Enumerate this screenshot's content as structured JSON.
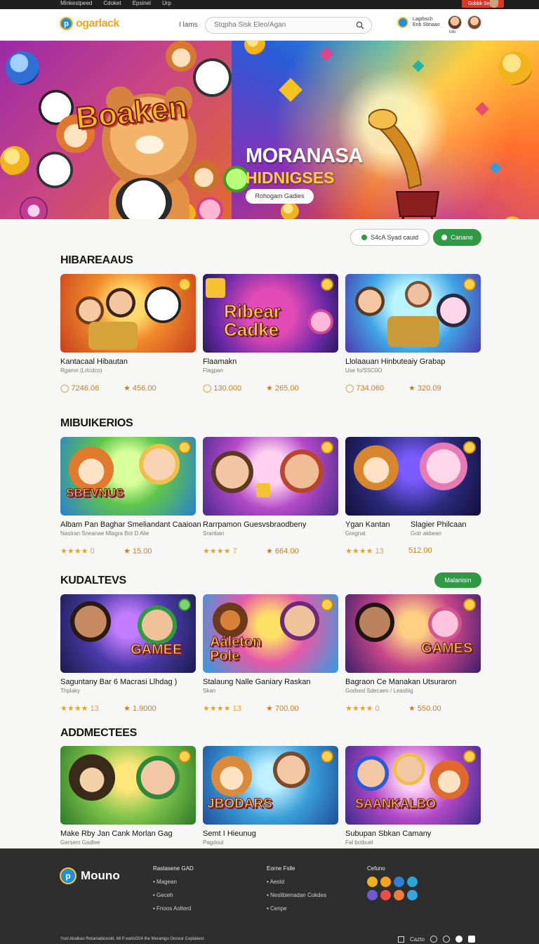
{
  "topbar": {
    "links": [
      "Minkestpeed",
      "Cdoket",
      "Epsinel",
      "Urp"
    ],
    "red_button": "Gobbk Sepho"
  },
  "header": {
    "logo_text": "ogarlack",
    "logo_letter": "p",
    "nav_item": "I lams",
    "search_placeholder": "Stqpha Sisk Eleo/Agan",
    "user_line1": "Lagrbsch",
    "user_line2": "Enb Sbnaao",
    "avatar_label": "lolo"
  },
  "banner": {
    "brand_word": "Boaken",
    "title": "MORANASA",
    "subtitle": "HIDNIGSES",
    "button": "Rohogam Gadies"
  },
  "actions": {
    "outline_button": "S4cA Syad cauid",
    "green_button": "Canane"
  },
  "sections": [
    {
      "title": "HIBAREAAUS",
      "button": "",
      "cards": [
        {
          "title": "Kantacaal Hibautan",
          "sub": "Rgamn (Lrtcdco)",
          "meta1": "◯ 7246.06",
          "meta2": "★ 456.00",
          "word": ""
        },
        {
          "title": "Flaamakn",
          "sub": "Flagpan",
          "meta1": "",
          "meta2": "",
          "word": "Ribear Cadke"
        },
        {
          "title": "Llolaauan Hinbuteaiy Grabap",
          "sub": "Use fo/SSC0O",
          "meta1": "◯ 734.060",
          "meta2": "★ 320.09",
          "word": ""
        }
      ]
    },
    {
      "title": "MIBUIKERIOS",
      "button": "",
      "cards": [
        {
          "title": "Albam Pan Baghar Smeliandant Caaioan",
          "sub": "Nastran Sneanae Mlagra Bot D Alie",
          "meta1": "★★★★ 0",
          "meta2": "★ 15.00",
          "word": "SBEVNUS"
        },
        {
          "title": "Rarrpamon Guesvsbraodbeny",
          "sub": "Sranban",
          "meta1": "★★★★ 7",
          "meta2": "★ 664.00",
          "word": ""
        },
        {
          "title": "Ygan Kantan",
          "sub": "Gregnat",
          "meta1": "★★★★ 13",
          "meta2": "512.00",
          "word": ""
        }
      ]
    },
    {
      "title": "KUDALTEVS",
      "button": "Malanisin",
      "cards": [
        {
          "title": "Saguntany Bar 6 Macrasi Llhdag )",
          "sub": "Thplaky",
          "meta1": "★★★★ 13",
          "meta2": "★ 1.9000",
          "word": "GAMEE"
        },
        {
          "title": "Stalaung Nalle Ganiary Raskan",
          "sub": "Skan",
          "meta1": "★★★★ 13",
          "meta2": "★ 700.00",
          "word": "Aáleton Pole"
        },
        {
          "title": "Bagraon Ce Manakan Utsuraron",
          "sub": "Godsed Sdecaen / Leasbig",
          "meta1": "★★★★ 0",
          "meta2": "★ 550.00",
          "word": "GAMES"
        }
      ]
    },
    {
      "title": "ADDMECTEES",
      "button": "",
      "cards": [
        {
          "title": "Make Rby Jan Cank Morlan Gag",
          "sub": "Gersem Gadlee",
          "meta1": "",
          "meta2": "",
          "word": ""
        },
        {
          "title": "Semt I Hieunug",
          "sub": "Pagdoul",
          "meta1": "",
          "meta2": "",
          "word": "JBODARS"
        },
        {
          "title": "Subupan Sbkan Camany",
          "sub": "Fal botbuel",
          "meta1": "",
          "meta2": "",
          "word": "SAANKALBO"
        }
      ]
    }
  ],
  "card_second_labels": [
    "",
    "",
    "Gotr akbean"
  ],
  "footer": {
    "logo_text": "Mouno",
    "col1_title": "Rastasene GAD",
    "col1_items": [
      "Magean",
      "Geceh",
      "Fnoos Aolterd"
    ],
    "col2_title": "Eorne Fslle",
    "col2_items": [
      "Aestd",
      "Neslibienadan Cokdes",
      "Cenpe"
    ],
    "col3_title": "Cefuno",
    "copyright": "Yuol Abalkao Rotamabicoold, Ml P earloO24 the Meranigo Ooceur Coplakest.",
    "bottom_label": "Cazto",
    "social_colors": [
      "#f2b21b",
      "#f3a41c",
      "#2e7fd8",
      "#2aa5d8",
      "#6c5bd3",
      "#e94d45",
      "#f07d3a",
      "#3ca2e0"
    ]
  }
}
